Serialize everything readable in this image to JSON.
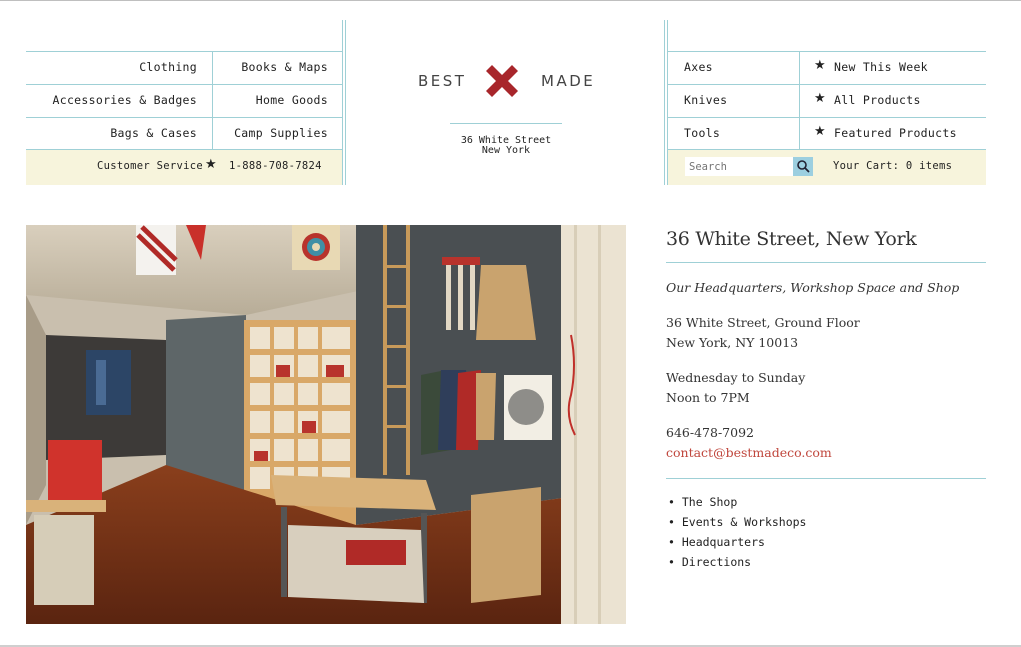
{
  "nav_left": {
    "col1": [
      "Clothing",
      "Accessories & Badges",
      "Bags & Cases"
    ],
    "col2": [
      "Books & Maps",
      "Home Goods",
      "Camp Supplies"
    ],
    "customer_service": "Customer Service",
    "phone": "1-888-708-7824"
  },
  "logo": {
    "left": "BEST",
    "right": "MADE",
    "accent_color": "#a8262b"
  },
  "header_address": {
    "line1": "36 White Street",
    "line2": "New York"
  },
  "nav_right": {
    "col1": [
      "Axes",
      "Knives",
      "Tools"
    ],
    "col2": [
      "New This Week",
      "All Products",
      "Featured Products"
    ],
    "search_placeholder": "Search",
    "cart": "Your Cart: 0 items"
  },
  "location": {
    "title": "36 White Street, New York",
    "subtitle": "Our Headquarters, Workshop Space and Shop",
    "address_line1": "36 White Street, Ground Floor",
    "address_line2": "New York, NY 10013",
    "hours_line1": "Wednesday to Sunday",
    "hours_line2": "Noon to 7PM",
    "phone": "646-478-7092",
    "email": "contact@bestmadeco.com"
  },
  "links": [
    "The Shop",
    "Events & Workshops",
    "Headquarters",
    "Directions"
  ],
  "colors": {
    "rule": "#9fd0d6",
    "bar": "#f7f4dc",
    "link": "#c0473d"
  }
}
